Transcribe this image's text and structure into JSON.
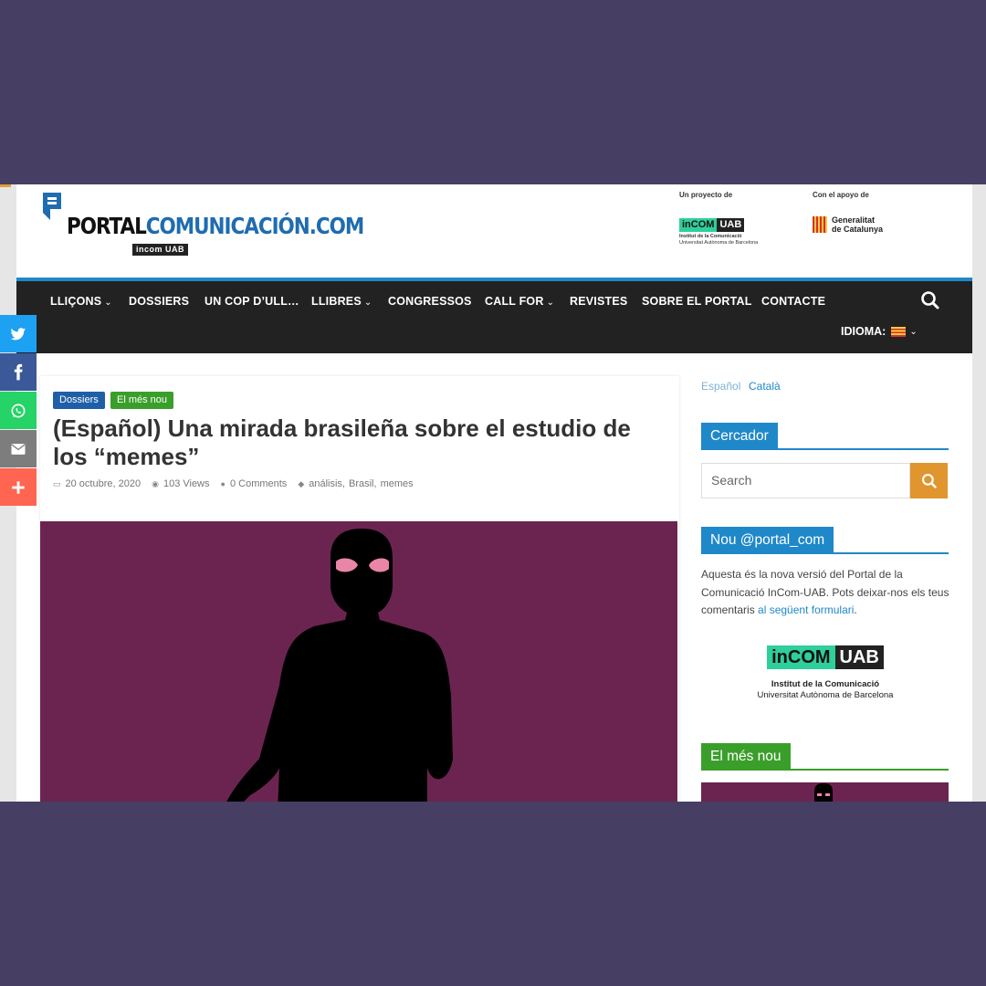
{
  "colors": {
    "background": "#463e63",
    "nav_bg": "#222222",
    "accent_blue": "#1f88c9",
    "accent_green": "#3a9f2a",
    "search_orange": "#e0952e",
    "feature_purple": "#6b2450"
  },
  "header": {
    "logo_part1": "PORTAL",
    "logo_part2": "COMUNICACIÓN.COM",
    "logo_sub": "incom UAB",
    "sponsor1_label": "Un proyecto de",
    "sponsor1_logo_a": "inCOM",
    "sponsor1_logo_b": "UAB",
    "sponsor1_caption1": "Institut de la Comunicació",
    "sponsor1_caption2": "Universitat Autònoma de Barcelona",
    "sponsor2_label": "Con el apoyo de",
    "sponsor2_line1": "Generalitat",
    "sponsor2_line2": "de Catalunya"
  },
  "nav": {
    "items": [
      {
        "label": "LLIÇONS",
        "chevron": "⌄"
      },
      {
        "label": "DOSSIERS",
        "chevron": ""
      },
      {
        "label": "UN COP D’ULL…",
        "chevron": ""
      },
      {
        "label": "LLIBRES",
        "chevron": "⌄"
      },
      {
        "label": "CONGRESSOS",
        "chevron": ""
      },
      {
        "label": "CALL FOR",
        "chevron": "⌄"
      },
      {
        "label": "REVISTES",
        "chevron": ""
      },
      {
        "label": "SOBRE EL PORTAL",
        "chevron": ""
      },
      {
        "label": "CONTACTE",
        "chevron": ""
      }
    ],
    "language_label": "IDIOMA:",
    "search_icon": "search-icon"
  },
  "share": [
    {
      "icon": "twitter-icon",
      "color": "#1da1f2"
    },
    {
      "icon": "facebook-icon",
      "color": "#3b5998"
    },
    {
      "icon": "whatsapp-icon",
      "color": "#25d366"
    },
    {
      "icon": "email-icon",
      "color": "#7d7d7d"
    },
    {
      "icon": "plus-icon",
      "color": "#ff6550"
    }
  ],
  "article": {
    "categories": [
      {
        "label": "Dossiers",
        "color": "#1f5fa8"
      },
      {
        "label": "El més nou",
        "color": "#3a9f2a"
      }
    ],
    "title": "(Español) Una mirada brasileña sobre el estudio de los “memes”",
    "date": "20 octubre, 2020",
    "views": "103 Views",
    "comments": "0 Comments",
    "tags": [
      "análisis",
      "Brasil",
      "memes"
    ]
  },
  "sidebar": {
    "lang_es": "Español",
    "lang_ca": "Català",
    "search_heading": "Cercador",
    "search_placeholder": "Search",
    "twitter_heading": "Nou @portal_com",
    "intro_text": "Aquesta és la nova versió del Portal de la Comunicació InCom-UAB. Pots deixar-nos els teus comentaris ",
    "intro_link": "al següent formulari",
    "intro_end": ".",
    "logo_a": "inCOM",
    "logo_b": "UAB",
    "logo_line1": "Institut de la Comunicació",
    "logo_line2": "Universitat Autònoma de Barcelona",
    "latest_heading": "El més nou"
  }
}
